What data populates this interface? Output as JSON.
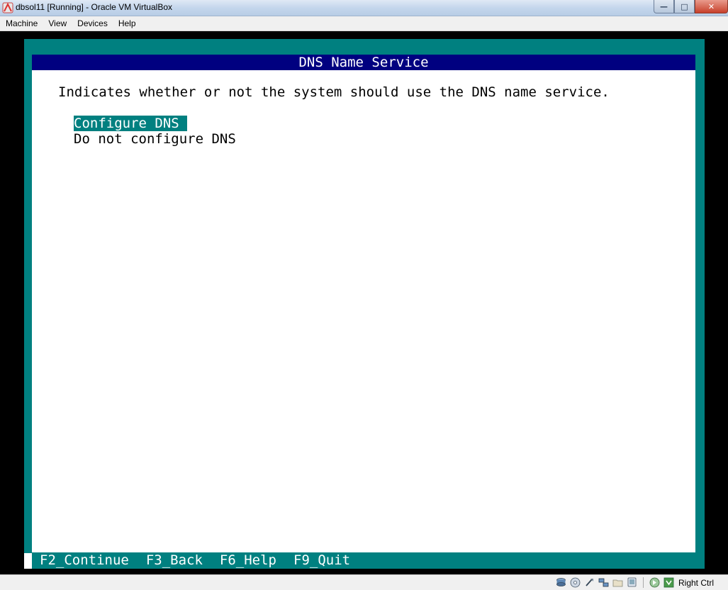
{
  "window": {
    "title": "dbsol11 [Running] - Oracle VM VirtualBox",
    "controls": {
      "minimize": "—",
      "maximize": "□",
      "close": "✕"
    }
  },
  "menubar": {
    "items": [
      {
        "label": "Machine"
      },
      {
        "label": "View"
      },
      {
        "label": "Devices"
      },
      {
        "label": "Help"
      }
    ]
  },
  "installer": {
    "header": "DNS Name Service",
    "description": "Indicates whether or not the system should use the DNS name service.",
    "options": [
      {
        "label": "Configure DNS",
        "selected": true
      },
      {
        "label": "Do not configure DNS",
        "selected": false
      }
    ],
    "footer_keys": [
      {
        "label": "F2_Continue"
      },
      {
        "label": "F3_Back"
      },
      {
        "label": "F6_Help"
      },
      {
        "label": "F9_Quit"
      }
    ]
  },
  "statusbar": {
    "icons": [
      "hard-disk-icon",
      "optical-drive-icon",
      "usb-icon",
      "network-icon",
      "shared-folders-icon",
      "display-icon",
      "mouse-integration-icon",
      "host-key-icon"
    ],
    "host_key": "Right Ctrl"
  },
  "colors": {
    "teal": "#008080",
    "header_blue": "#000080",
    "dialog_bg": "#ffffff"
  }
}
